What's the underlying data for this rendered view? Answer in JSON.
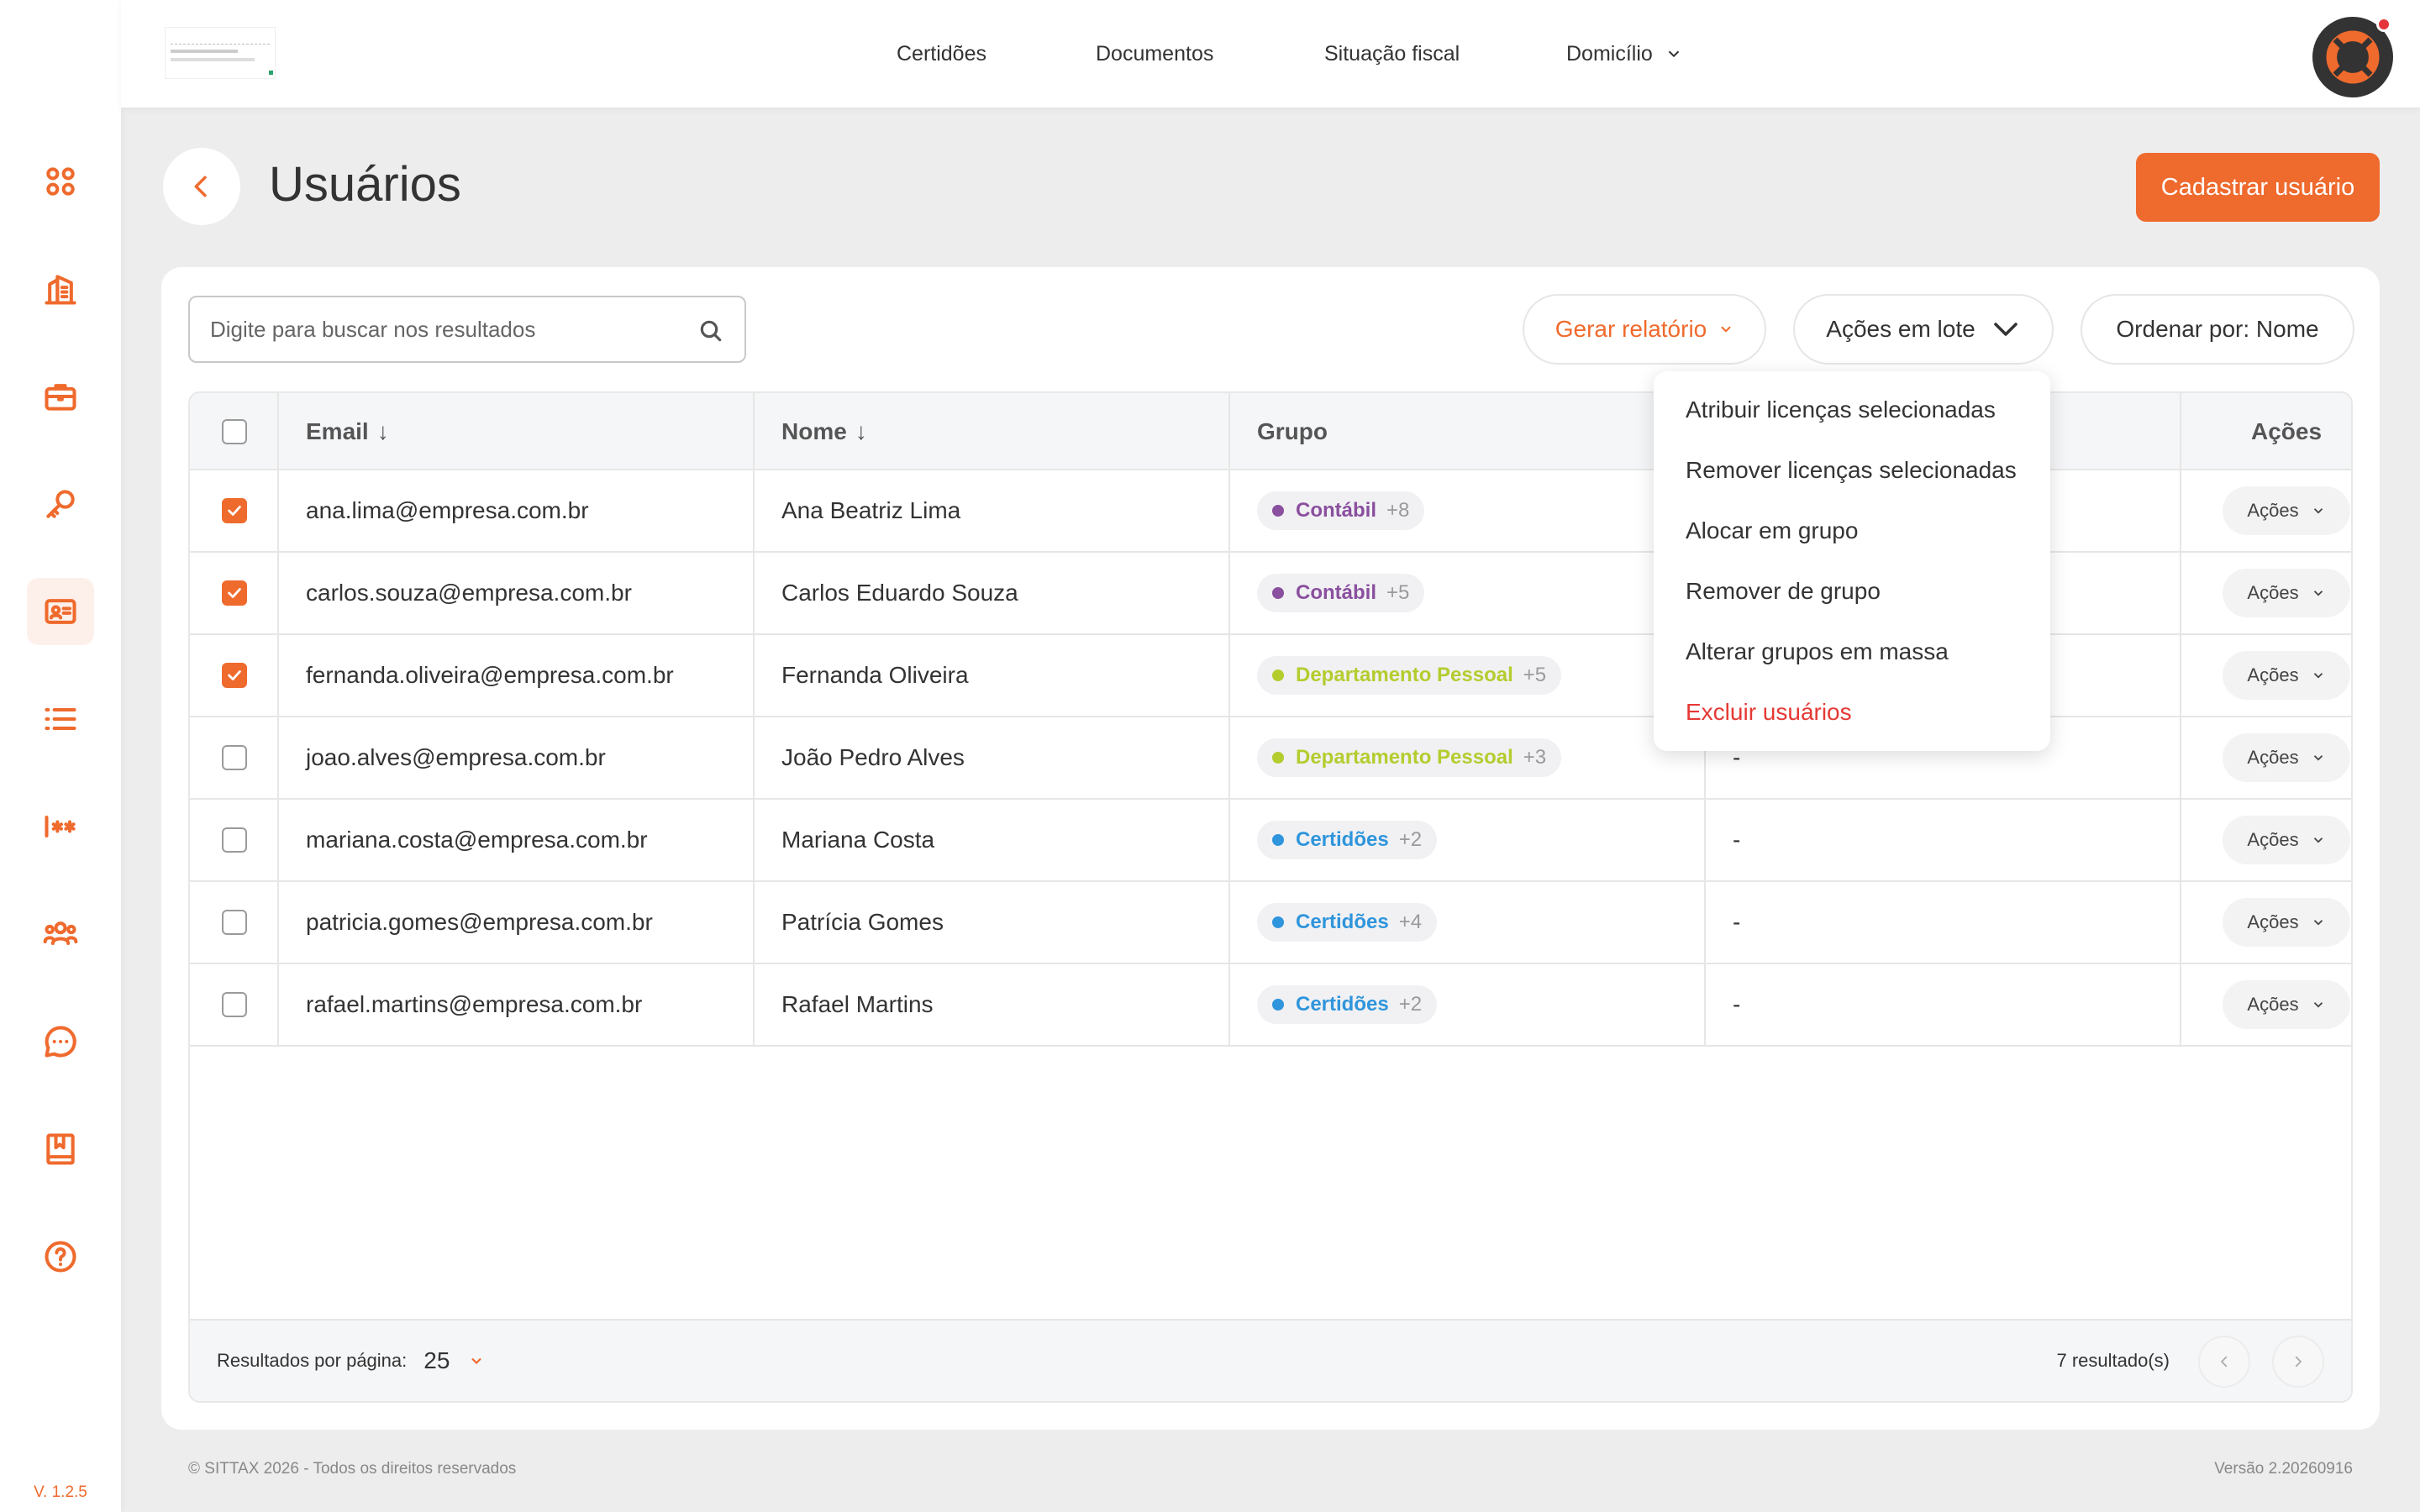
{
  "sidebar": {
    "items": [
      {
        "name": "dashboard",
        "icon": "grid-circles-icon"
      },
      {
        "name": "companies",
        "icon": "building-icon"
      },
      {
        "name": "services",
        "icon": "briefcase-icon"
      },
      {
        "name": "keys",
        "icon": "key-icon"
      },
      {
        "name": "users",
        "icon": "id-card-icon",
        "active": true
      },
      {
        "name": "lists",
        "icon": "list-icon"
      },
      {
        "name": "passwords",
        "icon": "password-icon"
      },
      {
        "name": "teams",
        "icon": "users-group-icon"
      },
      {
        "name": "chat",
        "icon": "chat-bubble-icon"
      },
      {
        "name": "guides",
        "icon": "book-icon"
      },
      {
        "name": "help",
        "icon": "help-circle-icon"
      }
    ],
    "version": "V. 1.2.5"
  },
  "topnav": {
    "items": [
      {
        "label": "Certidões"
      },
      {
        "label": "Documentos"
      },
      {
        "label": "Situação fiscal"
      },
      {
        "label": "Domicílio"
      }
    ]
  },
  "page": {
    "title": "Usuários",
    "primary_action": "Cadastrar usuário"
  },
  "toolbar": {
    "search_placeholder": "Digite para buscar nos resultados",
    "report_label": "Gerar relatório",
    "batch_label": "Ações em lote",
    "sort_label": "Ordenar por: Nome"
  },
  "table": {
    "columns": [
      "Email",
      "Nome",
      "Grupo",
      "Ações"
    ],
    "sort_arrow": "↓",
    "rows": [
      {
        "checked": true,
        "email": "ana.lima@empresa.com.br",
        "name": "Ana Beatriz Lima",
        "group": "Contábil",
        "group_more": "+8",
        "group_color": "#8a4f9e",
        "extra": "",
        "action": "Ações"
      },
      {
        "checked": true,
        "email": "carlos.souza@empresa.com.br",
        "name": "Carlos Eduardo Souza",
        "group": "Contábil",
        "group_more": "+5",
        "group_color": "#8a4f9e",
        "extra": "",
        "action": "Ações"
      },
      {
        "checked": true,
        "email": "fernanda.oliveira@empresa.com.br",
        "name": "Fernanda Oliveira",
        "group": "Departamento Pessoal",
        "group_more": "+5",
        "group_color": "#b5cc2e",
        "extra": "",
        "action": "Ações"
      },
      {
        "checked": false,
        "email": "joao.alves@empresa.com.br",
        "name": "João Pedro Alves",
        "group": "Departamento Pessoal",
        "group_more": "+3",
        "group_color": "#b5cc2e",
        "extra": "-",
        "action": "Ações"
      },
      {
        "checked": false,
        "email": "mariana.costa@empresa.com.br",
        "name": "Mariana Costa",
        "group": "Certidões",
        "group_more": "+2",
        "group_color": "#2f95dc",
        "extra": "-",
        "action": "Ações"
      },
      {
        "checked": false,
        "email": "patricia.gomes@empresa.com.br",
        "name": "Patrícia Gomes",
        "group": "Certidões",
        "group_more": "+4",
        "group_color": "#2f95dc",
        "extra": "-",
        "action": "Ações"
      },
      {
        "checked": false,
        "email": "rafael.martins@empresa.com.br",
        "name": "Rafael Martins",
        "group": "Certidões",
        "group_more": "+2",
        "group_color": "#2f95dc",
        "extra": "-",
        "action": "Ações"
      }
    ]
  },
  "pagination": {
    "per_page_label": "Resultados por página:",
    "per_page_value": "25",
    "results": "7 resultado(s)"
  },
  "batch_menu": {
    "items": [
      {
        "label": "Atribuir licenças selecionadas"
      },
      {
        "label": "Remover licenças selecionadas"
      },
      {
        "label": "Alocar em grupo"
      },
      {
        "label": "Remover de grupo"
      },
      {
        "label": "Alterar grupos em massa"
      },
      {
        "label": "Excluir usuários",
        "danger": true
      }
    ]
  },
  "footer": {
    "copyright": "© SITTAX 2026 - Todos os direitos reservados",
    "version": "Versão 2.20260916"
  },
  "colors": {
    "accent": "#ef6a2d",
    "danger": "#e53935"
  }
}
